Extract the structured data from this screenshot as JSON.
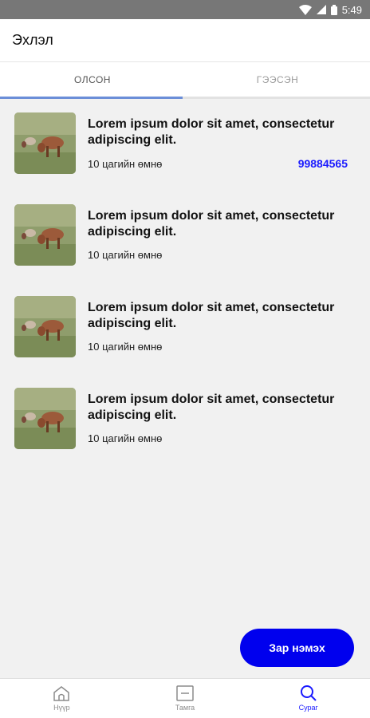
{
  "status_bar": {
    "time": "5:49"
  },
  "header": {
    "title": "Эхлэл"
  },
  "tabs": [
    {
      "label": "ОЛСОН",
      "active": true
    },
    {
      "label": "ГЭЭСЭН",
      "active": false
    }
  ],
  "list": {
    "items": [
      {
        "title": "Lorem ipsum dolor sit amet, consectetur adipiscing elit.",
        "time": "10 цагийн өмнө",
        "phone": "99884565"
      },
      {
        "title": "Lorem ipsum dolor sit amet, consectetur adipiscing elit.",
        "time": "10 цагийн өмнө",
        "phone": ""
      },
      {
        "title": "Lorem ipsum dolor sit amet, consectetur adipiscing elit.",
        "time": "10 цагийн өмнө",
        "phone": ""
      },
      {
        "title": "Lorem ipsum dolor sit amet, consectetur adipiscing elit.",
        "time": "10 цагийн өмнө",
        "phone": ""
      }
    ]
  },
  "fab": {
    "label": "Зар нэмэх"
  },
  "bottom_nav": [
    {
      "label": "Нүүр",
      "icon": "home-icon",
      "active": false
    },
    {
      "label": "Тамга",
      "icon": "stamp-icon",
      "active": false
    },
    {
      "label": "Сураг",
      "icon": "search-icon",
      "active": true
    }
  ],
  "colors": {
    "accent": "#0000ee",
    "active_nav": "#1a1aff",
    "tab_indicator": "#6b8ed8",
    "status_bar": "#777777"
  }
}
